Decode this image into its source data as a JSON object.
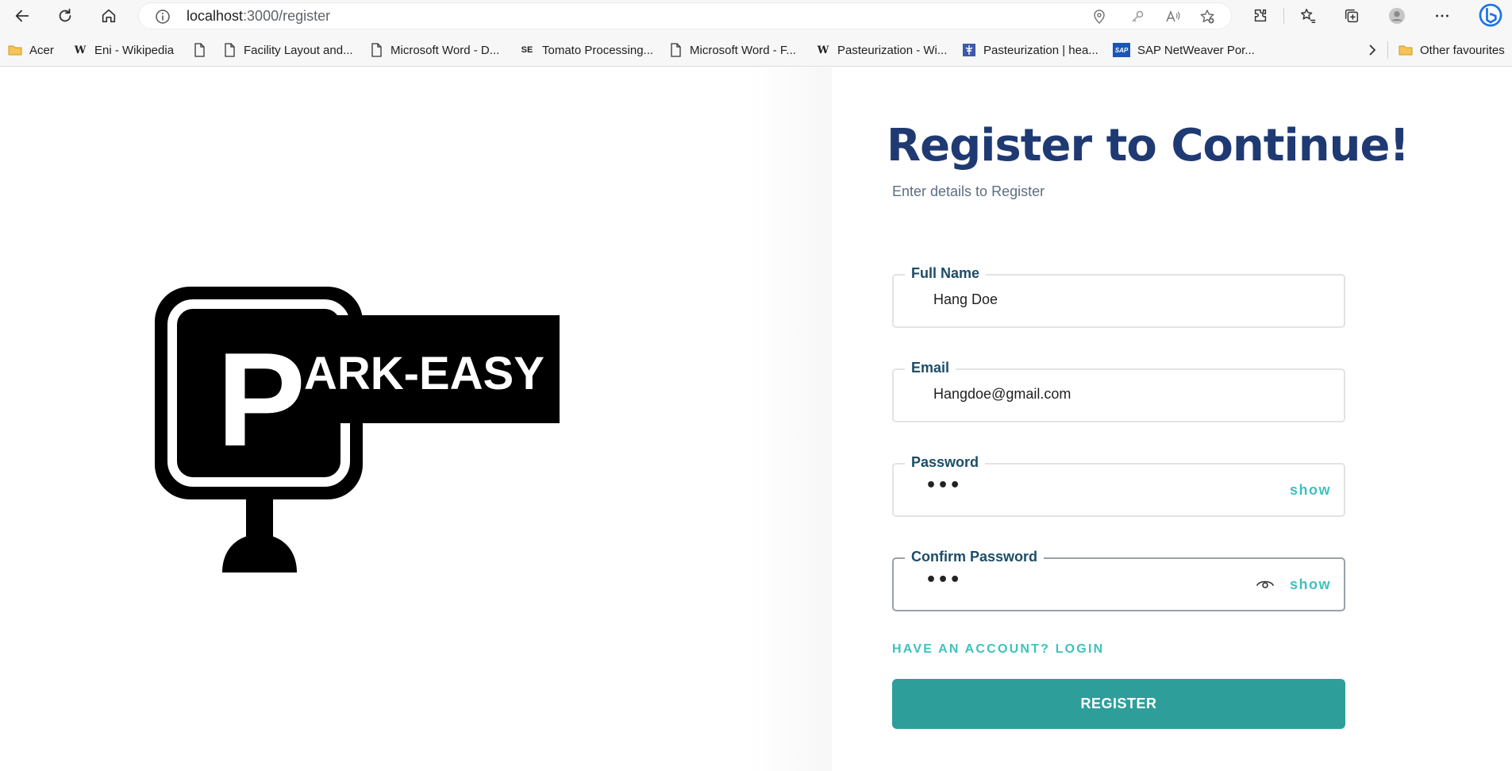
{
  "browser": {
    "url_host": "localhost",
    "url_path": ":3000/register",
    "bookmarks": [
      {
        "label": "Acer",
        "icon": "folder-icon"
      },
      {
        "label": "Eni - Wikipedia",
        "icon": "wikipedia-icon"
      },
      {
        "label": "",
        "icon": "page-icon"
      },
      {
        "label": "Facility Layout and...",
        "icon": "page-icon"
      },
      {
        "label": "Microsoft Word - D...",
        "icon": "page-icon"
      },
      {
        "label": "Tomato Processing...",
        "icon": "se-icon"
      },
      {
        "label": "Microsoft Word - F...",
        "icon": "page-icon"
      },
      {
        "label": "Pasteurization - Wi...",
        "icon": "wikipedia-icon"
      },
      {
        "label": "Pasteurization | hea...",
        "icon": "site-icon"
      },
      {
        "label": "SAP NetWeaver Por...",
        "icon": "sap-icon"
      }
    ],
    "other_favourites": "Other favourites",
    "se_glyph": "SE",
    "wiki_glyph": "W",
    "sap_glyph": "SAP"
  },
  "page": {
    "logo_letter": "P",
    "logo_text": "ARK-EASY",
    "title": "Register to Continue!",
    "subtitle": "Enter details to Register",
    "fields": [
      {
        "label": "Full Name",
        "value": "Hang Doe"
      },
      {
        "label": "Email",
        "value": "Hangdoe@gmail.com"
      },
      {
        "label": "Password",
        "value": "•••",
        "toggle": "show"
      },
      {
        "label": "Confirm Password",
        "value": "•••",
        "toggle": "show"
      }
    ],
    "login_link": "HAVE AN ACCOUNT? LOGIN",
    "register_button": "REGISTER"
  },
  "colors": {
    "title": "#1f3a73",
    "label": "#1c4d68",
    "accent": "#3fc1bd",
    "button": "#2e9e9b"
  }
}
